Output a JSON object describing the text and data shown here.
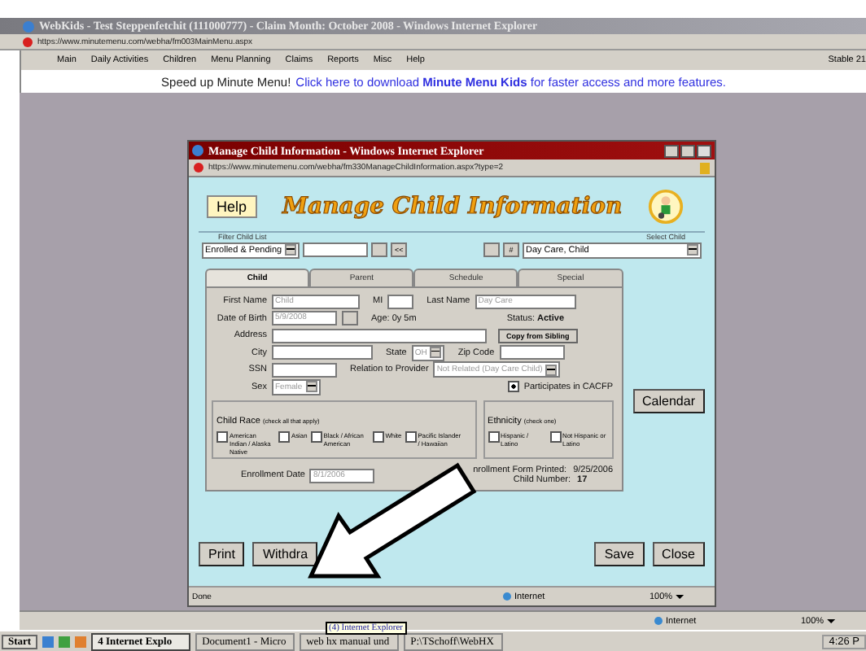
{
  "browser": {
    "title": "WebKids - Test Steppenfetchit (111000777) - Claim Month: October 2008 - Windows Internet Explorer",
    "url": "https://www.minutemenu.com/webha/fm003MainMenu.aspx",
    "menu": [
      "Main",
      "Daily Activities",
      "Children",
      "Menu Planning",
      "Claims",
      "Reports",
      "Misc",
      "Help"
    ],
    "build": "Stable 21"
  },
  "banner": {
    "lead": "Speed up Minute Menu!",
    "link": "Click here to download **Minute Menu Kids** for faster access and more features."
  },
  "popup": {
    "title": "Manage Child Information - Windows Internet Explorer",
    "url": "https://www.minutemenu.com/webha/fm330ManageChildInformation.aspx?type=2",
    "help": "Help",
    "heading": "Manage Child Information",
    "filter": {
      "label": "Filter Child List",
      "value": "Enrolled & Pending",
      "button": "<<"
    },
    "select": {
      "label": "Select Child",
      "button": "#",
      "value": "Day Care, Child"
    },
    "tabs": [
      {
        "label": "Child",
        "selected": true
      },
      {
        "label": "Parent",
        "selected": false
      },
      {
        "label": "Schedule",
        "selected": false
      },
      {
        "label": "Special",
        "selected": false
      }
    ],
    "child": {
      "first_name": {
        "label": "First Name",
        "value": "Child",
        "disabled": true
      },
      "mi": {
        "label": "MI"
      },
      "last_name": {
        "label": "Last Name",
        "value": "Day Care",
        "disabled": true
      },
      "dob": {
        "label": "Date of Birth",
        "value": "5/9/2008",
        "disabled": true
      },
      "age": "Age: 0y 5m",
      "status": "Status: **Active**",
      "address": {
        "label": "Address"
      },
      "copy_button": "Copy from Sibling",
      "city": {
        "label": "City"
      },
      "state": {
        "label": "State",
        "value": "OH",
        "disabled": true
      },
      "zip": {
        "label": "Zip Code"
      },
      "ssn": {
        "label": "SSN"
      },
      "relation": {
        "label": "Relation to Provider",
        "value": "Not Related (Day Care Child)",
        "disabled": true
      },
      "sex": {
        "label": "Sex",
        "value": "Female",
        "disabled": true
      },
      "cacfp": {
        "label": "Participates in CACFP",
        "checked": true
      }
    },
    "race": {
      "label": "Child Race",
      "hint": "(check all that apply)",
      "options": [
        {
          "label": "American Indian / Alaska Native",
          "checked": false
        },
        {
          "label": "Asian",
          "checked": false
        },
        {
          "label": "Black / African American",
          "checked": false
        },
        {
          "label": "White",
          "checked": false
        },
        {
          "label": "Pacific Islander / Hawaiian",
          "checked": false
        }
      ]
    },
    "ethnicity": {
      "label": "Ethnicity",
      "hint": "(check one)",
      "options": [
        {
          "label": "Hispanic / Latino",
          "checked": false
        },
        {
          "label": "Not Hispanic or Latino",
          "checked": false
        }
      ]
    },
    "enrollment": {
      "label": "Enrollment Date",
      "value": "8/1/2006",
      "disabled": true,
      "form_printed": "nrollment Form Printed:",
      "printed_date": "9/25/2006",
      "number_label": "Child Number:",
      "number": "17"
    },
    "calendar": "Calendar",
    "buttons_left": [
      "Print",
      "Withdra"
    ],
    "buttons_right": [
      "Save",
      "Close"
    ],
    "status": "Done",
    "zone": "Internet",
    "zoom": "100%"
  },
  "outer_status": {
    "zone": "Internet",
    "zoom": "100%"
  },
  "tooltip": "(4) Internet Explorer",
  "taskbar": {
    "start": "Start",
    "tasks": [
      {
        "label": "4 Internet Explo",
        "selected": true
      },
      {
        "label": "Document1 - Micro",
        "selected": false
      },
      {
        "label": "web hx manual und",
        "selected": false
      },
      {
        "label": "P:\\TSchoff\\WebHX",
        "selected": false
      }
    ],
    "clock": "4:26 P"
  }
}
